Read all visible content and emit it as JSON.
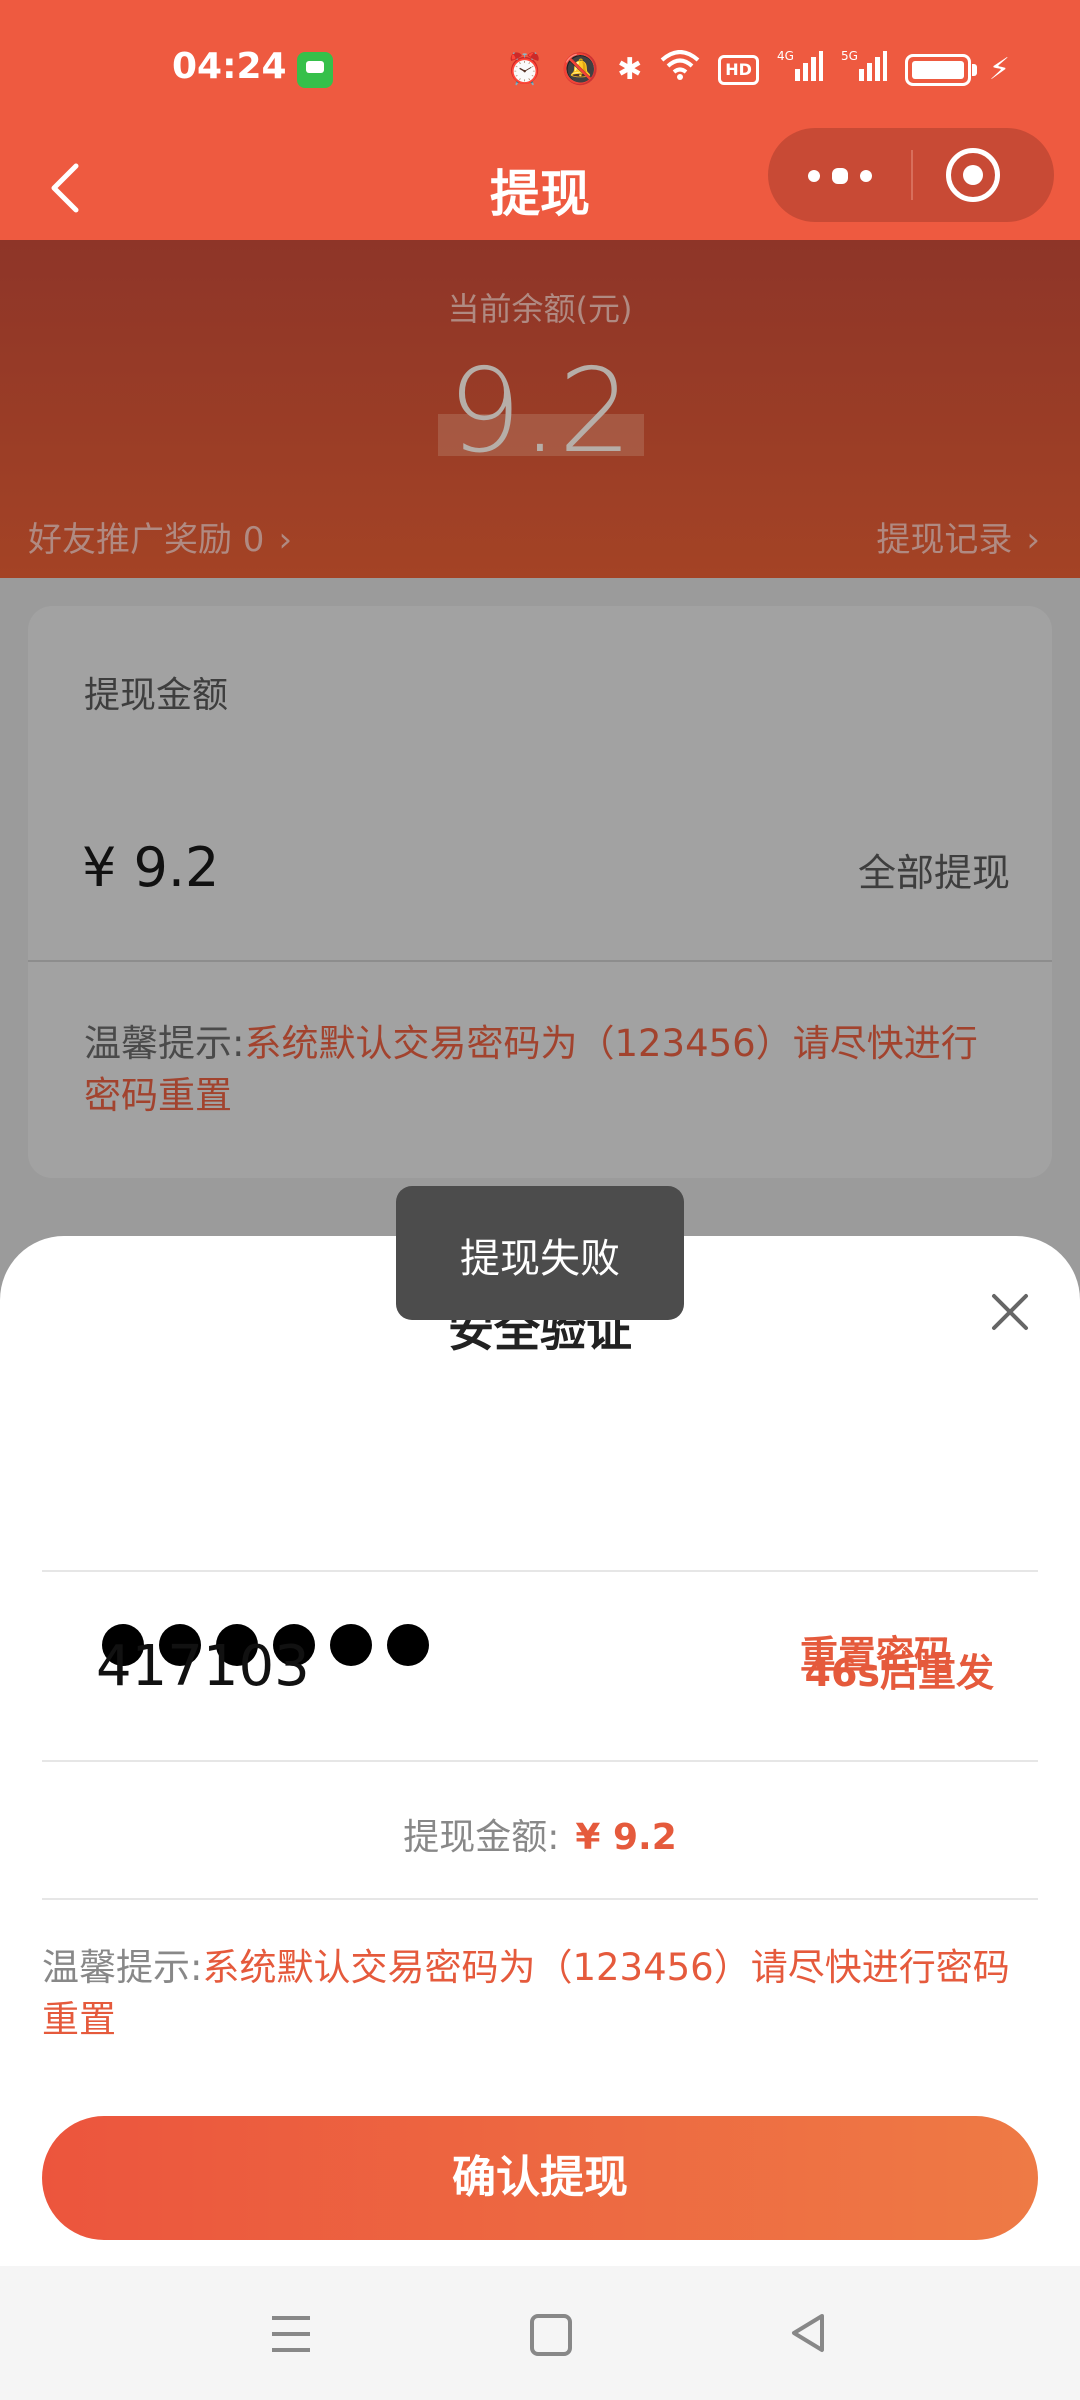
{
  "status_bar": {
    "time": "04:24",
    "icons": [
      "message-app-icon",
      "alarm-icon",
      "mute-icon",
      "bluetooth-icon",
      "wifi-icon",
      "hd-icon",
      "4g-signal-icon",
      "5g-signal-icon",
      "battery-icon",
      "charging-icon"
    ],
    "hd_label": "HD",
    "net_4g": "4G",
    "net_5g": "5G"
  },
  "header": {
    "title": "提现"
  },
  "balance": {
    "label": "当前余额(元)",
    "amount": "9.2",
    "promo_label": "好友推广奖励 0",
    "records_label": "提现记录"
  },
  "withdraw_card": {
    "label": "提现金额",
    "amount": "¥  9.2",
    "withdraw_all": "全部提现",
    "tip_prefix": "温馨提示:",
    "tip_text": "系统默认交易密码为（123456）请尽快进行密码重置"
  },
  "toast": {
    "message": "提现失败"
  },
  "sheet": {
    "title": "安全验证",
    "password_dots": 6,
    "reset_password": "重置密码",
    "code_value": "417103",
    "resend_label": "46s后重发",
    "amount_label": "提现金额:",
    "amount_value": "¥ 9.2",
    "tip_prefix": "温馨提示:",
    "tip_text": "系统默认交易密码为（123456）请尽快进行密码重置",
    "confirm_label": "确认提现"
  },
  "colors": {
    "brand": "#ee5a40",
    "accent_text": "#e55a3c",
    "toast_bg": "#4c4c4c"
  }
}
